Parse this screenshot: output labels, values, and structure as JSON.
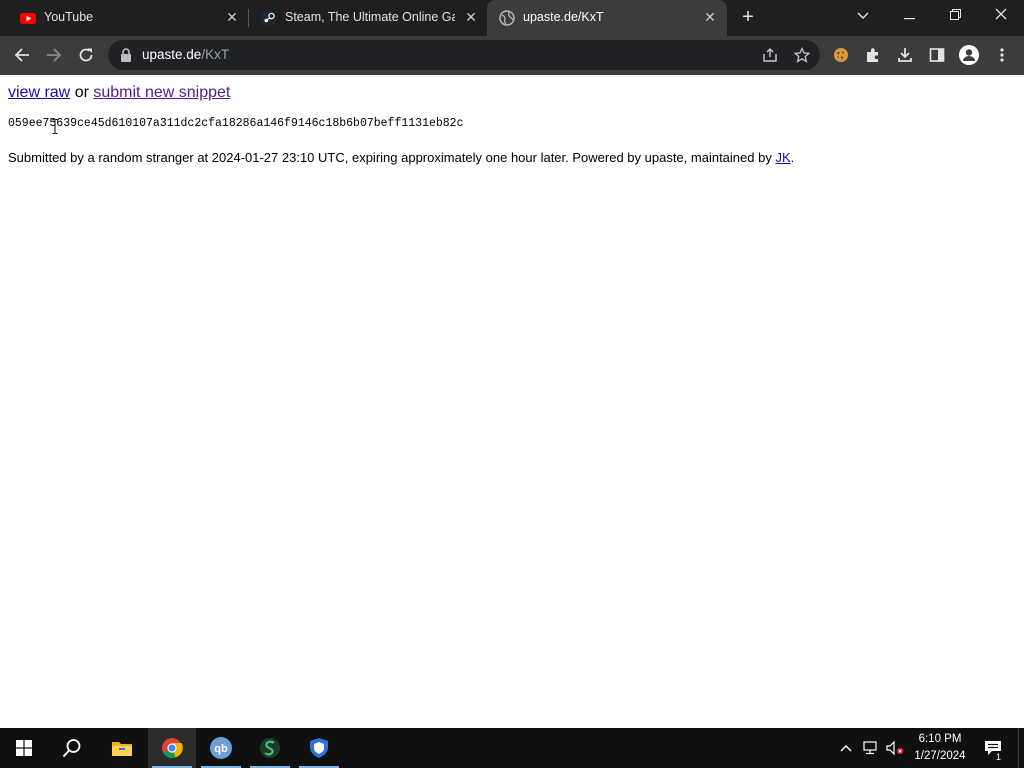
{
  "browser": {
    "tabs": [
      {
        "title": "YouTube",
        "icon": "youtube-icon",
        "active": false
      },
      {
        "title": "Steam, The Ultimate Online Gam",
        "icon": "steam-icon",
        "active": false
      },
      {
        "title": "upaste.de/KxT",
        "icon": "globe-icon",
        "active": true
      }
    ],
    "address": {
      "host": "upaste.de",
      "path": "/KxT"
    }
  },
  "page": {
    "view_raw": "view raw",
    "or_text": "or",
    "submit_new": "submit new snippet",
    "hash": "059ee75639ce45d610107a311dc2cfa18286a146f9146c18b6b07beff1131eb82c",
    "footer_text": "Submitted by a random stranger at 2024-01-27 23:10 UTC, expiring approximately one hour later. Powered by upaste, maintained by",
    "footer_link": "JK",
    "footer_end": "."
  },
  "taskbar": {
    "apps": [
      "start-icon",
      "search-icon",
      "file-explorer-icon",
      "chrome-icon",
      "qbittorrent-icon",
      "app-icon",
      "vpn-shield-icon"
    ],
    "time": "6:10 PM",
    "date": "1/27/2024",
    "notification_count": "1"
  },
  "colors": {
    "accent": "#76b9ed",
    "link": "#1a0dab",
    "visited": "#551a8b"
  }
}
